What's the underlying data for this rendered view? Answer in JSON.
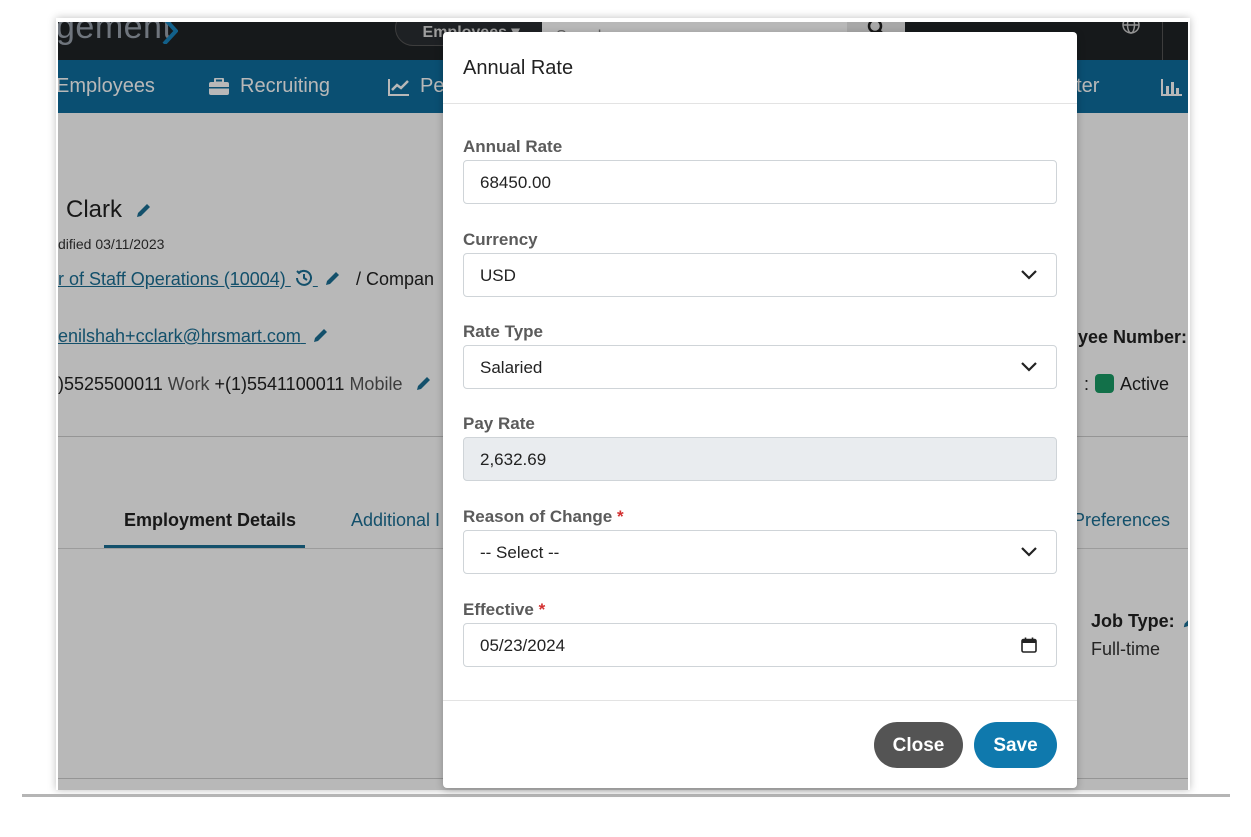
{
  "topbar": {
    "logo_text": "gement",
    "employees_dropdown": "Employees ▾",
    "search_placeholder": "Search..."
  },
  "nav": {
    "employees": "Employees",
    "recruiting": "Recruiting",
    "performance": "Pe",
    "center": "nter"
  },
  "profile": {
    "name": "Clark",
    "modified": "dified 03/11/2023",
    "position_link": "r of Staff Operations (10004)",
    "company_prefix": "/   Compan",
    "email": "enilshah+cclark@hrsmart.com",
    "phone_work": ")5525500011",
    "phone_work_label": "Work",
    "phone_mobile": "+(1)5541100011",
    "phone_mobile_label": "Mobile",
    "employee_number_label": "yee Number:",
    "status_label": ":",
    "status_value": "Active"
  },
  "tabs": {
    "employment_details": "Employment Details",
    "additional": "Additional I",
    "preferences": "Preferences"
  },
  "job": {
    "type_label": "Job Type:",
    "type_value": "Full-time"
  },
  "modal": {
    "title": "Annual Rate",
    "annual_rate_label": "Annual Rate",
    "annual_rate_value": "68450.00",
    "currency_label": "Currency",
    "currency_value": "USD",
    "rate_type_label": "Rate Type",
    "rate_type_value": "Salaried",
    "pay_rate_label": "Pay Rate",
    "pay_rate_value": "2,632.69",
    "reason_label": "Reason of Change",
    "reason_value": "-- Select --",
    "effective_label": "Effective",
    "effective_value": "05/23/2024",
    "required_mark": "*",
    "close_label": "Close",
    "save_label": "Save"
  },
  "colors": {
    "nav_blue": "#0f6e9e",
    "save_blue": "#0f79ad",
    "close_gray": "#545454",
    "active_green": "#1a9c66",
    "required_red": "#d32f2f"
  }
}
